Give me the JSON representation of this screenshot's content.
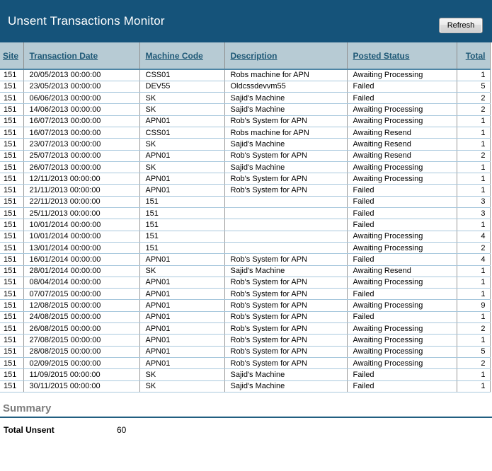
{
  "header": {
    "title": "Unsent Transactions Monitor",
    "refresh_button": "Refresh"
  },
  "table": {
    "columns": [
      {
        "key": "site",
        "label": "Site"
      },
      {
        "key": "transaction-date",
        "label": "Transaction Date"
      },
      {
        "key": "machine-code",
        "label": "Machine Code"
      },
      {
        "key": "description",
        "label": "Description"
      },
      {
        "key": "posted-status",
        "label": "Posted Status"
      },
      {
        "key": "total",
        "label": "Total",
        "align": "right"
      }
    ],
    "rows": [
      [
        "151",
        "20/05/2013 00:00:00",
        "CSS01",
        "Robs machine for APN",
        "Awaiting Processing",
        "1"
      ],
      [
        "151",
        "23/05/2013 00:00:00",
        "DEV55",
        "Oldcssdevvm55",
        "Failed",
        "5"
      ],
      [
        "151",
        "06/06/2013 00:00:00",
        "SK",
        "Sajid's Machine",
        "Failed",
        "2"
      ],
      [
        "151",
        "14/06/2013 00:00:00",
        "SK",
        "Sajid's Machine",
        "Awaiting Processing",
        "2"
      ],
      [
        "151",
        "16/07/2013 00:00:00",
        "APN01",
        "Rob's System for APN",
        "Awaiting Processing",
        "1"
      ],
      [
        "151",
        "16/07/2013 00:00:00",
        "CSS01",
        "Robs machine for APN",
        "Awaiting Resend",
        "1"
      ],
      [
        "151",
        "23/07/2013 00:00:00",
        "SK",
        "Sajid's Machine",
        "Awaiting Resend",
        "1"
      ],
      [
        "151",
        "25/07/2013 00:00:00",
        "APN01",
        "Rob's System for APN",
        "Awaiting Resend",
        "2"
      ],
      [
        "151",
        "26/07/2013 00:00:00",
        "SK",
        "Sajid's Machine",
        "Awaiting Processing",
        "1"
      ],
      [
        "151",
        "12/11/2013 00:00:00",
        "APN01",
        "Rob's System for APN",
        "Awaiting Processing",
        "1"
      ],
      [
        "151",
        "21/11/2013 00:00:00",
        "APN01",
        "Rob's System for APN",
        "Failed",
        "1"
      ],
      [
        "151",
        "22/11/2013 00:00:00",
        "151",
        "",
        "Failed",
        "3"
      ],
      [
        "151",
        "25/11/2013 00:00:00",
        "151",
        "",
        "Failed",
        "3"
      ],
      [
        "151",
        "10/01/2014 00:00:00",
        "151",
        "",
        "Failed",
        "1"
      ],
      [
        "151",
        "10/01/2014 00:00:00",
        "151",
        "",
        "Awaiting Processing",
        "4"
      ],
      [
        "151",
        "13/01/2014 00:00:00",
        "151",
        "",
        "Awaiting Processing",
        "2"
      ],
      [
        "151",
        "16/01/2014 00:00:00",
        "APN01",
        "Rob's System for APN",
        "Failed",
        "4"
      ],
      [
        "151",
        "28/01/2014 00:00:00",
        "SK",
        "Sajid's Machine",
        "Awaiting Resend",
        "1"
      ],
      [
        "151",
        "08/04/2014 00:00:00",
        "APN01",
        "Rob's System for APN",
        "Awaiting Processing",
        "1"
      ],
      [
        "151",
        "07/07/2015 00:00:00",
        "APN01",
        "Rob's System for APN",
        "Failed",
        "1"
      ],
      [
        "151",
        "12/08/2015 00:00:00",
        "APN01",
        "Rob's System for APN",
        "Awaiting Processing",
        "9"
      ],
      [
        "151",
        "24/08/2015 00:00:00",
        "APN01",
        "Rob's System for APN",
        "Failed",
        "1"
      ],
      [
        "151",
        "26/08/2015 00:00:00",
        "APN01",
        "Rob's System for APN",
        "Awaiting Processing",
        "2"
      ],
      [
        "151",
        "27/08/2015 00:00:00",
        "APN01",
        "Rob's System for APN",
        "Awaiting Processing",
        "1"
      ],
      [
        "151",
        "28/08/2015 00:00:00",
        "APN01",
        "Rob's System for APN",
        "Awaiting Processing",
        "5"
      ],
      [
        "151",
        "02/09/2015 00:00:00",
        "APN01",
        "Rob's System for APN",
        "Awaiting Processing",
        "2"
      ],
      [
        "151",
        "11/09/2015 00:00:00",
        "SK",
        "Sajid's Machine",
        "Failed",
        "1"
      ],
      [
        "151",
        "30/11/2015 00:00:00",
        "SK",
        "Sajid's Machine",
        "Failed",
        "1"
      ]
    ]
  },
  "summary": {
    "heading": "Summary",
    "total_label": "Total Unsent",
    "total_value": "60"
  },
  "colors": {
    "top_bar": "#15537A",
    "table_header_bg": "#B7CBD4",
    "table_header_text": "#1E5876",
    "row_border": "#A8C8DD",
    "column_border": "#999999",
    "header_bottom_border": "#4E85A5",
    "summary_heading": "#7D7D7D",
    "summary_divider": "#215E80"
  }
}
